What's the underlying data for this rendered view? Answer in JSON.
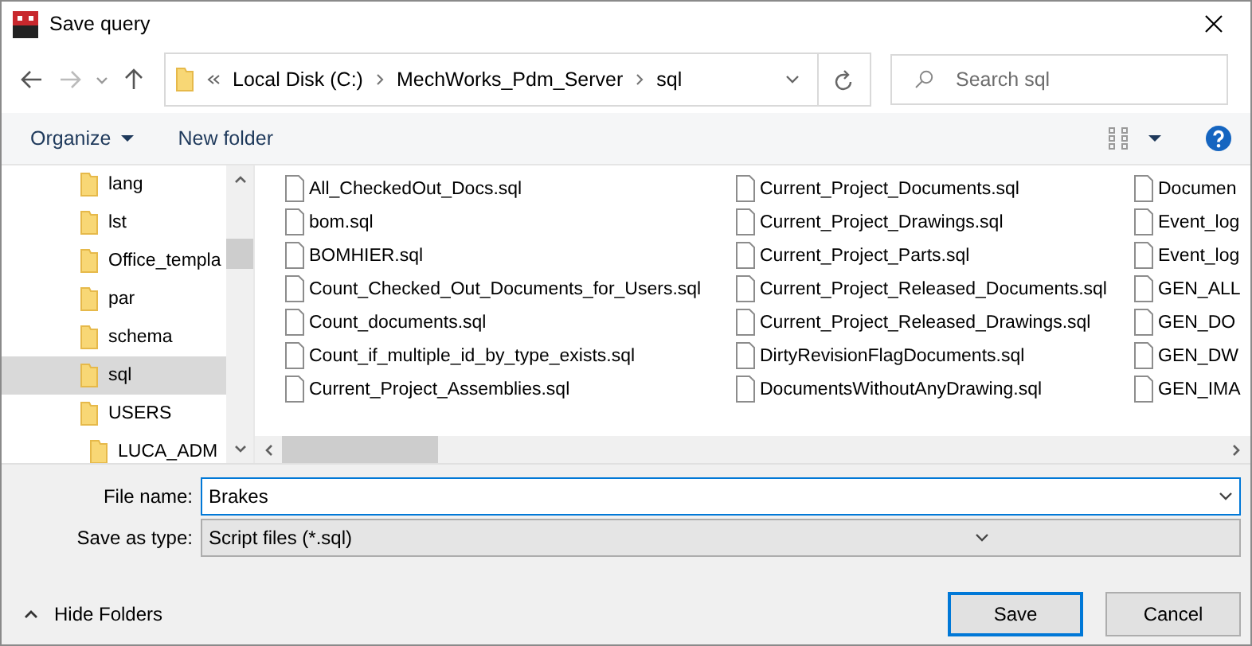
{
  "window": {
    "title": "Save query"
  },
  "navigation": {
    "breadcrumbs": [
      "Local Disk (C:)",
      "MechWorks_Pdm_Server",
      "sql"
    ],
    "search": {
      "placeholder": "Search sql"
    }
  },
  "toolbar": {
    "organize": "Organize",
    "new_folder": "New folder"
  },
  "folder_tree": [
    {
      "label": "lang",
      "selected": false
    },
    {
      "label": "lst",
      "selected": false
    },
    {
      "label": "Office_templa",
      "selected": false
    },
    {
      "label": "par",
      "selected": false
    },
    {
      "label": "schema",
      "selected": false
    },
    {
      "label": "sql",
      "selected": true
    },
    {
      "label": "USERS",
      "selected": false,
      "children": [
        {
          "label": "LUCA_ADM",
          "selected": false
        }
      ]
    }
  ],
  "files": {
    "columns": [
      {
        "items": [
          "All_CheckedOut_Docs.sql",
          "bom.sql",
          "BOMHIER.sql",
          "Count_Checked_Out_Documents_for_Users.sql",
          "Count_documents.sql",
          "Count_if_multiple_id_by_type_exists.sql",
          "Current_Project_Assemblies.sql"
        ]
      },
      {
        "items": [
          "Current_Project_Documents.sql",
          "Current_Project_Drawings.sql",
          "Current_Project_Parts.sql",
          "Current_Project_Released_Documents.sql",
          "Current_Project_Released_Drawings.sql",
          "DirtyRevisionFlagDocuments.sql",
          "DocumentsWithoutAnyDrawing.sql"
        ]
      },
      {
        "items": [
          "Documen",
          "Event_log",
          "Event_log",
          "GEN_ALL",
          "GEN_DO",
          "GEN_DW",
          "GEN_IMA"
        ]
      }
    ]
  },
  "form": {
    "file_name": {
      "label": "File name:",
      "value": "Brakes"
    },
    "save_as_type": {
      "label": "Save as type:",
      "value": "Script files (*.sql)"
    }
  },
  "footer": {
    "hide_folders": "Hide Folders",
    "buttons": [
      {
        "label": "Save",
        "default": true
      },
      {
        "label": "Cancel",
        "default": false
      }
    ]
  }
}
